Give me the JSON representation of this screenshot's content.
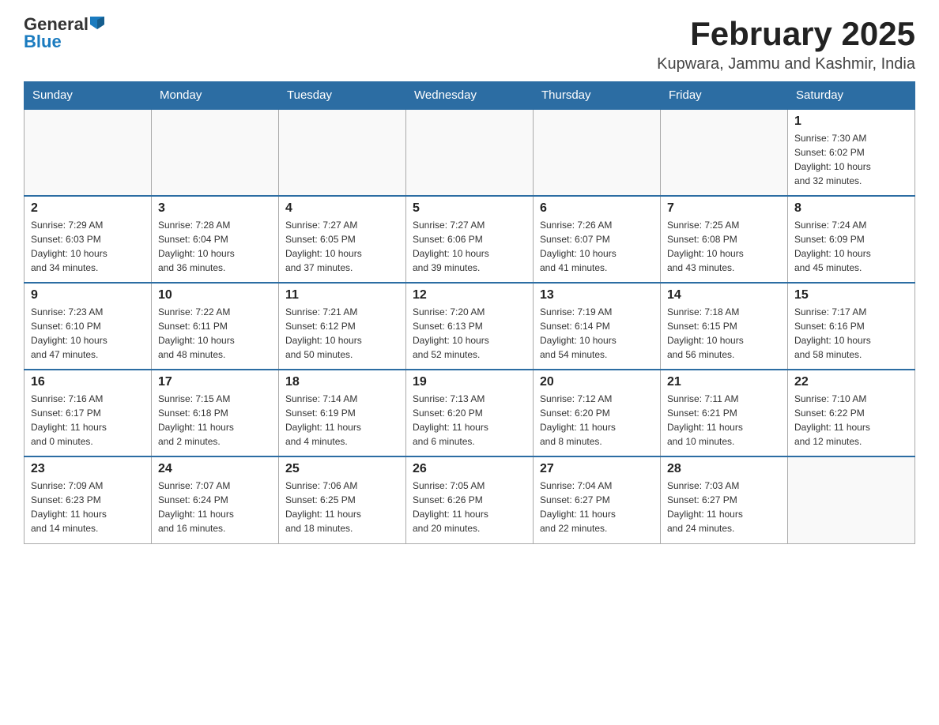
{
  "header": {
    "logo": {
      "general": "General",
      "blue": "Blue"
    },
    "title": "February 2025",
    "location": "Kupwara, Jammu and Kashmir, India"
  },
  "days_of_week": [
    "Sunday",
    "Monday",
    "Tuesday",
    "Wednesday",
    "Thursday",
    "Friday",
    "Saturday"
  ],
  "weeks": [
    {
      "days": [
        {
          "number": "",
          "info": ""
        },
        {
          "number": "",
          "info": ""
        },
        {
          "number": "",
          "info": ""
        },
        {
          "number": "",
          "info": ""
        },
        {
          "number": "",
          "info": ""
        },
        {
          "number": "",
          "info": ""
        },
        {
          "number": "1",
          "info": "Sunrise: 7:30 AM\nSunset: 6:02 PM\nDaylight: 10 hours\nand 32 minutes."
        }
      ]
    },
    {
      "days": [
        {
          "number": "2",
          "info": "Sunrise: 7:29 AM\nSunset: 6:03 PM\nDaylight: 10 hours\nand 34 minutes."
        },
        {
          "number": "3",
          "info": "Sunrise: 7:28 AM\nSunset: 6:04 PM\nDaylight: 10 hours\nand 36 minutes."
        },
        {
          "number": "4",
          "info": "Sunrise: 7:27 AM\nSunset: 6:05 PM\nDaylight: 10 hours\nand 37 minutes."
        },
        {
          "number": "5",
          "info": "Sunrise: 7:27 AM\nSunset: 6:06 PM\nDaylight: 10 hours\nand 39 minutes."
        },
        {
          "number": "6",
          "info": "Sunrise: 7:26 AM\nSunset: 6:07 PM\nDaylight: 10 hours\nand 41 minutes."
        },
        {
          "number": "7",
          "info": "Sunrise: 7:25 AM\nSunset: 6:08 PM\nDaylight: 10 hours\nand 43 minutes."
        },
        {
          "number": "8",
          "info": "Sunrise: 7:24 AM\nSunset: 6:09 PM\nDaylight: 10 hours\nand 45 minutes."
        }
      ]
    },
    {
      "days": [
        {
          "number": "9",
          "info": "Sunrise: 7:23 AM\nSunset: 6:10 PM\nDaylight: 10 hours\nand 47 minutes."
        },
        {
          "number": "10",
          "info": "Sunrise: 7:22 AM\nSunset: 6:11 PM\nDaylight: 10 hours\nand 48 minutes."
        },
        {
          "number": "11",
          "info": "Sunrise: 7:21 AM\nSunset: 6:12 PM\nDaylight: 10 hours\nand 50 minutes."
        },
        {
          "number": "12",
          "info": "Sunrise: 7:20 AM\nSunset: 6:13 PM\nDaylight: 10 hours\nand 52 minutes."
        },
        {
          "number": "13",
          "info": "Sunrise: 7:19 AM\nSunset: 6:14 PM\nDaylight: 10 hours\nand 54 minutes."
        },
        {
          "number": "14",
          "info": "Sunrise: 7:18 AM\nSunset: 6:15 PM\nDaylight: 10 hours\nand 56 minutes."
        },
        {
          "number": "15",
          "info": "Sunrise: 7:17 AM\nSunset: 6:16 PM\nDaylight: 10 hours\nand 58 minutes."
        }
      ]
    },
    {
      "days": [
        {
          "number": "16",
          "info": "Sunrise: 7:16 AM\nSunset: 6:17 PM\nDaylight: 11 hours\nand 0 minutes."
        },
        {
          "number": "17",
          "info": "Sunrise: 7:15 AM\nSunset: 6:18 PM\nDaylight: 11 hours\nand 2 minutes."
        },
        {
          "number": "18",
          "info": "Sunrise: 7:14 AM\nSunset: 6:19 PM\nDaylight: 11 hours\nand 4 minutes."
        },
        {
          "number": "19",
          "info": "Sunrise: 7:13 AM\nSunset: 6:20 PM\nDaylight: 11 hours\nand 6 minutes."
        },
        {
          "number": "20",
          "info": "Sunrise: 7:12 AM\nSunset: 6:20 PM\nDaylight: 11 hours\nand 8 minutes."
        },
        {
          "number": "21",
          "info": "Sunrise: 7:11 AM\nSunset: 6:21 PM\nDaylight: 11 hours\nand 10 minutes."
        },
        {
          "number": "22",
          "info": "Sunrise: 7:10 AM\nSunset: 6:22 PM\nDaylight: 11 hours\nand 12 minutes."
        }
      ]
    },
    {
      "days": [
        {
          "number": "23",
          "info": "Sunrise: 7:09 AM\nSunset: 6:23 PM\nDaylight: 11 hours\nand 14 minutes."
        },
        {
          "number": "24",
          "info": "Sunrise: 7:07 AM\nSunset: 6:24 PM\nDaylight: 11 hours\nand 16 minutes."
        },
        {
          "number": "25",
          "info": "Sunrise: 7:06 AM\nSunset: 6:25 PM\nDaylight: 11 hours\nand 18 minutes."
        },
        {
          "number": "26",
          "info": "Sunrise: 7:05 AM\nSunset: 6:26 PM\nDaylight: 11 hours\nand 20 minutes."
        },
        {
          "number": "27",
          "info": "Sunrise: 7:04 AM\nSunset: 6:27 PM\nDaylight: 11 hours\nand 22 minutes."
        },
        {
          "number": "28",
          "info": "Sunrise: 7:03 AM\nSunset: 6:27 PM\nDaylight: 11 hours\nand 24 minutes."
        },
        {
          "number": "",
          "info": ""
        }
      ]
    }
  ]
}
